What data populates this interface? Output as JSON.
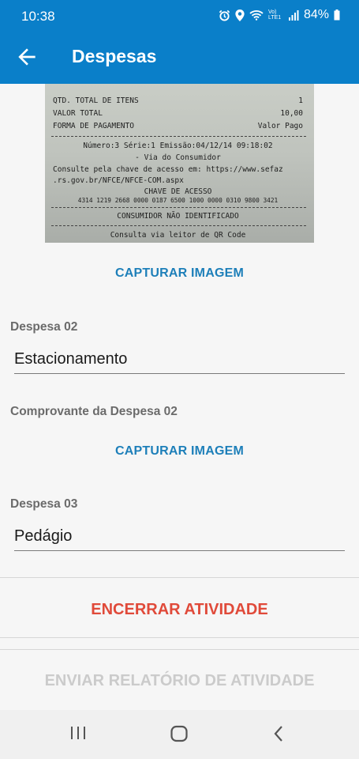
{
  "status": {
    "time": "10:38",
    "battery": "84%",
    "network": "Vo) LTE1"
  },
  "appbar": {
    "title": "Despesas"
  },
  "receipt": {
    "lines": {
      "l1_left": "QTD. TOTAL DE ITENS",
      "l1_right": "1",
      "l2_left": "VALOR TOTAL",
      "l2_right": "10,00",
      "l3_left": "FORMA DE PAGAMENTO",
      "l3_right": "Valor Pago",
      "l4": "Número:3 Série:1 Emissão:04/12/14 09:18:02",
      "l5": "- Via do Consumidor",
      "l6": "Consulte pela chave de acesso em: https://www.sefaz",
      "l7": ".rs.gov.br/NFCE/NFCE-COM.aspx",
      "l8": "CHAVE DE ACESSO",
      "l9": "4314 1219 2668 0000 0187 6500 1000 0000 0310 9800 3421",
      "l10": "CONSUMIDOR NÃO IDENTIFICADO",
      "l11": "Consulta via leitor de QR Code"
    }
  },
  "form": {
    "capture_label": "CAPTURAR IMAGEM",
    "despesa02_label": "Despesa 02",
    "despesa02_value": "Estacionamento",
    "comprovante02_label": "Comprovante da Despesa 02",
    "despesa03_label": "Despesa 03",
    "despesa03_value": "Pedágio"
  },
  "actions": {
    "encerrar": "ENCERRAR ATIVIDADE",
    "enviar": "ENVIAR RELATÓRIO DE ATIVIDADE"
  },
  "colors": {
    "primary": "#0a7fc9",
    "link": "#1d7fb9",
    "danger": "#e04a3a",
    "disabled": "#c8c8c8"
  }
}
